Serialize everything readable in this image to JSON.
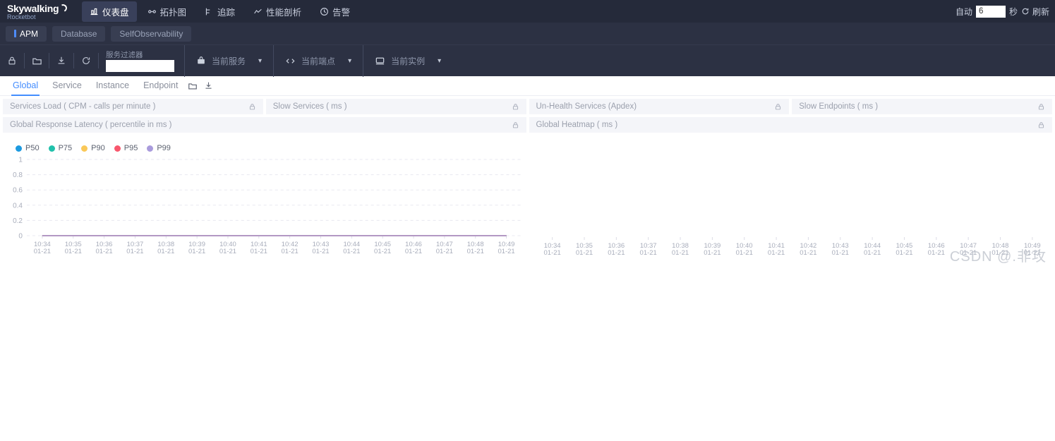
{
  "brand": {
    "name": "Skywalking",
    "sub": "Rocketbot"
  },
  "topnav": {
    "items": [
      {
        "label": "仪表盘",
        "icon": "dashboard-icon",
        "active": true
      },
      {
        "label": "拓扑图",
        "icon": "topology-icon",
        "active": false
      },
      {
        "label": "追踪",
        "icon": "trace-icon",
        "active": false
      },
      {
        "label": "性能剖析",
        "icon": "profiling-icon",
        "active": false
      },
      {
        "label": "告警",
        "icon": "alarm-icon",
        "active": false
      }
    ],
    "auto_label": "自动",
    "auto_value": "6",
    "unit_label": "秒",
    "refresh_label": "刷新"
  },
  "dashboard_tabs": [
    {
      "label": "APM",
      "active": true
    },
    {
      "label": "Database",
      "active": false
    },
    {
      "label": "SelfObservability",
      "active": false
    }
  ],
  "toolbar": {
    "icons": [
      "lock-icon",
      "folder-icon",
      "download-icon",
      "reload-icon"
    ],
    "filter": {
      "label": "服务过滤器",
      "value": "",
      "placeholder": ""
    },
    "selectors": [
      {
        "label": "当前服务",
        "icon": "service-bag-icon"
      },
      {
        "label": "当前端点",
        "icon": "endpoint-code-icon"
      },
      {
        "label": "当前实例",
        "icon": "instance-monitor-icon"
      }
    ]
  },
  "subtabs": {
    "items": [
      {
        "label": "Global",
        "active": true
      },
      {
        "label": "Service",
        "active": false
      },
      {
        "label": "Instance",
        "active": false
      },
      {
        "label": "Endpoint",
        "active": false
      }
    ],
    "icons": [
      "folder-icon",
      "download-icon"
    ]
  },
  "widgets_row1": [
    {
      "title": "Services Load ( CPM - calls per minute )",
      "lock": "lock-icon"
    },
    {
      "title": "Slow Services ( ms )",
      "lock": "lock-icon"
    },
    {
      "title": "Un-Health Services (Apdex)",
      "lock": "lock-icon"
    },
    {
      "title": "Slow Endpoints ( ms )",
      "lock": "lock-icon"
    }
  ],
  "widgets_row2": [
    {
      "title": "Global Response Latency ( percentile in ms )",
      "lock": "lock-icon"
    },
    {
      "title": "Global Heatmap ( ms )",
      "lock": "lock-icon"
    }
  ],
  "watermark": "CSDN @.非攻",
  "chart_data": [
    {
      "type": "line",
      "title": "Global Response Latency ( percentile in ms )",
      "xlabel": "",
      "ylabel": "",
      "ylim": [
        0,
        1
      ],
      "yticks": [
        "0",
        "0.2",
        "0.4",
        "0.6",
        "0.8",
        "1"
      ],
      "grid": true,
      "legend_position": "top-left",
      "x": [
        "10:34\n01-21",
        "10:35\n01-21",
        "10:36\n01-21",
        "10:37\n01-21",
        "10:38\n01-21",
        "10:39\n01-21",
        "10:40\n01-21",
        "10:41\n01-21",
        "10:42\n01-21",
        "10:43\n01-21",
        "10:44\n01-21",
        "10:45\n01-21",
        "10:46\n01-21",
        "10:47\n01-21",
        "10:48\n01-21",
        "10:49\n01-21"
      ],
      "series": [
        {
          "name": "P50",
          "color": "#1c9ae0",
          "values": [
            0,
            0,
            0,
            0,
            0,
            0,
            0,
            0,
            0,
            0,
            0,
            0,
            0,
            0,
            0,
            0
          ]
        },
        {
          "name": "P75",
          "color": "#21c1ab",
          "values": [
            0,
            0,
            0,
            0,
            0,
            0,
            0,
            0,
            0,
            0,
            0,
            0,
            0,
            0,
            0,
            0
          ]
        },
        {
          "name": "P90",
          "color": "#fac858",
          "values": [
            0,
            0,
            0,
            0,
            0,
            0,
            0,
            0,
            0,
            0,
            0,
            0,
            0,
            0,
            0,
            0
          ]
        },
        {
          "name": "P95",
          "color": "#f8576d",
          "values": [
            0,
            0,
            0,
            0,
            0,
            0,
            0,
            0,
            0,
            0,
            0,
            0,
            0,
            0,
            0,
            0
          ]
        },
        {
          "name": "P99",
          "color": "#a99bdc",
          "values": [
            0,
            0,
            0,
            0,
            0,
            0,
            0,
            0,
            0,
            0,
            0,
            0,
            0,
            0,
            0,
            0
          ]
        }
      ]
    },
    {
      "type": "heatmap",
      "title": "Global Heatmap ( ms )",
      "xlabel": "",
      "ylabel": "",
      "grid": false,
      "x": [
        "10:34\n01-21",
        "10:35\n01-21",
        "10:36\n01-21",
        "10:37\n01-21",
        "10:38\n01-21",
        "10:39\n01-21",
        "10:40\n01-21",
        "10:41\n01-21",
        "10:42\n01-21",
        "10:43\n01-21",
        "10:44\n01-21",
        "10:45\n01-21",
        "10:46\n01-21",
        "10:47\n01-21",
        "10:48\n01-21",
        "10:49\n01-21"
      ],
      "values": []
    }
  ]
}
